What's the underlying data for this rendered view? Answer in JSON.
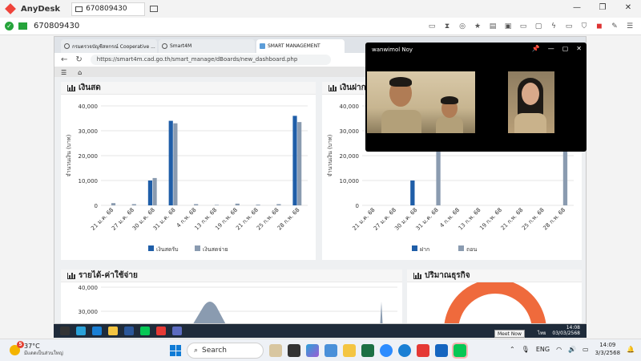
{
  "anydesk": {
    "app_name": "AnyDesk",
    "tab_label": "670809430",
    "session_id": "670809430"
  },
  "browser": {
    "tabs": [
      "กรมตรวจบัญชีสหกรณ์ Cooperative ...",
      "Smart4M",
      "SMART MANAGEMENT"
    ],
    "url": "https://smart4m.cad.go.th/smart_manage/dBoards/new_dashboard.php"
  },
  "dashboard": {
    "panel1_title": "เงินสด",
    "panel2_title": "เงินฝาก",
    "panel3_title": "รายได้-ค่าใช้จ่าย",
    "panel4_title": "ปริมาณธุรกิจ"
  },
  "chart_data": [
    {
      "type": "bar",
      "title": "เงินสด",
      "ylabel": "จำนวนเงิน (บาท)",
      "ylim": [
        0,
        40000
      ],
      "yticks": [
        "0",
        "10,000",
        "20,000",
        "30,000",
        "40,000"
      ],
      "categories": [
        "21 ม.ค. 68",
        "27 ม.ค. 68",
        "30 ม.ค. 68",
        "31 ม.ค. 68",
        "4 ก.พ. 68",
        "13 ก.พ. 68",
        "19 ก.พ. 68",
        "21 ก.พ. 68",
        "25 ก.พ. 68",
        "28 ก.พ. 68"
      ],
      "series": [
        {
          "name": "เงินสดรับ",
          "color": "#1f5ea8",
          "values": [
            0,
            0,
            10000,
            34000,
            0,
            0,
            0,
            0,
            0,
            36000
          ]
        },
        {
          "name": "เงินสดจ่าย",
          "color": "#8a9bb0",
          "values": [
            900,
            500,
            11000,
            33000,
            500,
            200,
            700,
            300,
            500,
            33500
          ]
        }
      ],
      "legend": "bottom"
    },
    {
      "type": "bar",
      "title": "เงินฝาก",
      "ylabel": "จำนวนเงิน (บาท)",
      "ylim": [
        0,
        40000
      ],
      "yticks": [
        "0",
        "10,000",
        "20,000",
        "30,000",
        "40,000"
      ],
      "categories": [
        "21 ม.ค. 68",
        "27 ม.ค. 68",
        "30 ม.ค. 68",
        "31 ม.ค. 68",
        "4 ก.พ. 68",
        "13 ก.พ. 68",
        "19 ก.พ. 68",
        "21 ก.พ. 68",
        "25 ก.พ. 68",
        "28 ก.พ. 68"
      ],
      "series": [
        {
          "name": "ฝาก",
          "color": "#1f5ea8",
          "values": [
            0,
            0,
            10000,
            0,
            0,
            0,
            0,
            0,
            0,
            0
          ]
        },
        {
          "name": "ถอน",
          "color": "#8a9bb0",
          "values": [
            0,
            0,
            0,
            34000,
            0,
            0,
            0,
            0,
            0,
            36000
          ]
        }
      ],
      "legend": "bottom"
    },
    {
      "type": "area",
      "title": "รายได้-ค่าใช้จ่าย",
      "yticks": [
        "30,000",
        "40,000"
      ]
    }
  ],
  "video_call": {
    "title": "wanwimol Noy"
  },
  "remote_taskbar": {
    "time": "14:08",
    "date": "03/03/2568",
    "lang": "ไทย",
    "tooltip": "Meet Now"
  },
  "taskbar": {
    "weather_temp": "37°C",
    "weather_cond": "มีแดดเป็นส่วนใหญ่",
    "weather_badge": "5",
    "search_label": "Search",
    "lang": "ENG",
    "time": "14:09",
    "date": "3/3/2568"
  }
}
